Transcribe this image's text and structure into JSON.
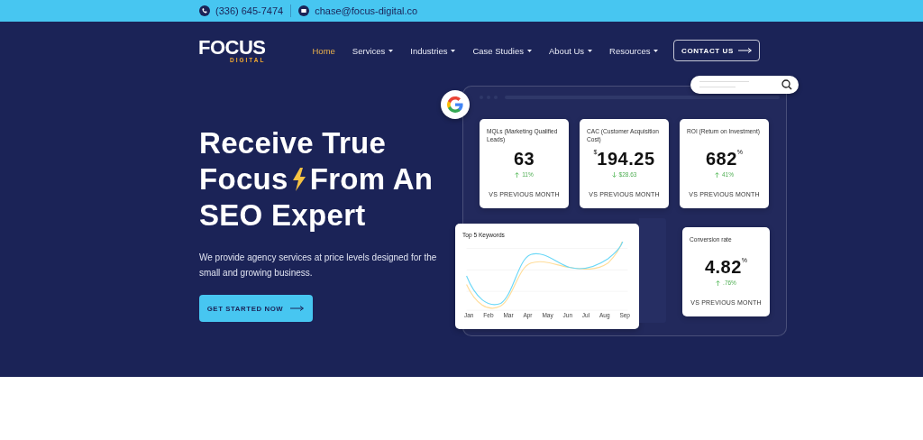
{
  "top_bar": {
    "phone": "(336) 645-7474",
    "email": "chase@focus-digital.co"
  },
  "logo": {
    "name": "FOCUS",
    "tagline": "DIGITAL"
  },
  "nav": [
    {
      "label": "Home",
      "selected": true,
      "dropdown": false
    },
    {
      "label": "Services",
      "selected": false,
      "dropdown": true
    },
    {
      "label": "Industries",
      "selected": false,
      "dropdown": true
    },
    {
      "label": "Case Studies",
      "selected": false,
      "dropdown": true
    },
    {
      "label": "About Us",
      "selected": false,
      "dropdown": true
    },
    {
      "label": "Resources",
      "selected": false,
      "dropdown": true
    }
  ],
  "contact_button": "CONTACT US",
  "hero": {
    "headline_lines": [
      [
        "Receive True"
      ],
      [
        "Focus",
        "From An"
      ],
      [
        "SEO Expert"
      ]
    ],
    "text": "We provide agency services at price levels designed for the small and growing business.",
    "button": "GET STARTED NOW"
  },
  "metrics": [
    {
      "label": "MQLs (Marketing Qualified Leads)",
      "value": "63",
      "change": "11%",
      "rising": true,
      "footer": "VS PREVIOUS MONTH"
    },
    {
      "label": "CAC (Customer Acquisition Cost)",
      "prefix": "$",
      "value": "194.25",
      "change": "$28.63",
      "rising": false,
      "footer": "VS PREVIOUS MONTH"
    },
    {
      "label": "ROI (Return on Investment)",
      "value": "682",
      "suffix": "%",
      "change": "41%",
      "rising": true,
      "footer": "VS PREVIOUS MONTH"
    }
  ],
  "keywords_chart": {
    "title": "Top 5 Keywords",
    "x_labels": [
      "Jan",
      "Feb",
      "Mar",
      "Apr",
      "May",
      "Jun",
      "Jul",
      "Aug",
      "Sep"
    ]
  },
  "conversion": {
    "label": "Conversion rate",
    "value": "4.82",
    "suffix": "%",
    "change": ".76%",
    "rising": true,
    "footer": "VS PREVIOUS MONTH"
  }
}
